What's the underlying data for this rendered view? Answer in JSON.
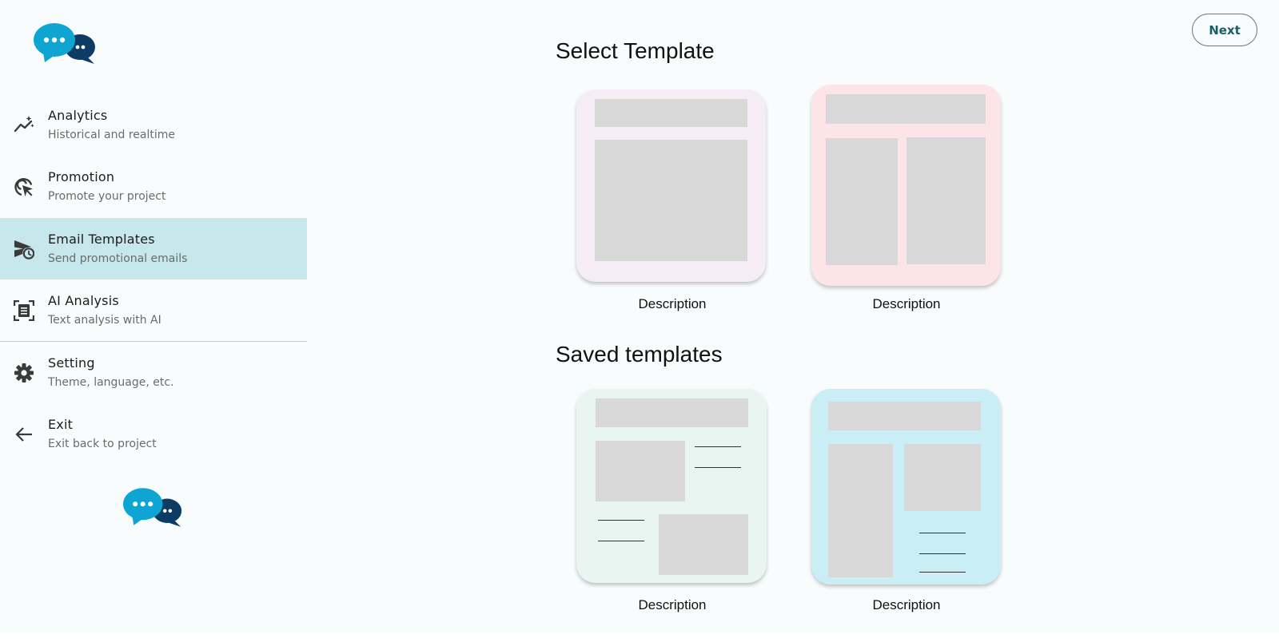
{
  "sidebar": {
    "items": [
      {
        "title": "Analytics",
        "subtitle": "Historical and realtime",
        "icon": "analytics-icon"
      },
      {
        "title": "Promotion",
        "subtitle": "Promote your project",
        "icon": "promotion-icon"
      },
      {
        "title": "Email Templates",
        "subtitle": "Send promotional emails",
        "icon": "scheduled-send-icon",
        "active": true
      },
      {
        "title": "AI Analysis",
        "subtitle": "Text analysis with AI",
        "icon": "document-scanner-icon"
      },
      {
        "title": "Setting",
        "subtitle": "Theme, language, etc.",
        "icon": "gear-icon"
      },
      {
        "title": "Exit",
        "subtitle": "Exit back to project",
        "icon": "arrow-back-icon"
      }
    ]
  },
  "header": {
    "next_label": "Next"
  },
  "main": {
    "select_title": "Select Template",
    "saved_title": "Saved templates",
    "templates": [
      {
        "description": "Description",
        "color": "#f6ecf6"
      },
      {
        "description": "Description",
        "color": "#fde4e6"
      }
    ],
    "saved": [
      {
        "description": "Description",
        "color": "#e8f5f0"
      },
      {
        "description": "Description",
        "color": "#c9eef6"
      }
    ]
  },
  "colors": {
    "active_bg": "#c6e7eb",
    "accent": "#1a5e66",
    "logo_light": "#0ea5d2",
    "logo_dark": "#0c3b66"
  }
}
